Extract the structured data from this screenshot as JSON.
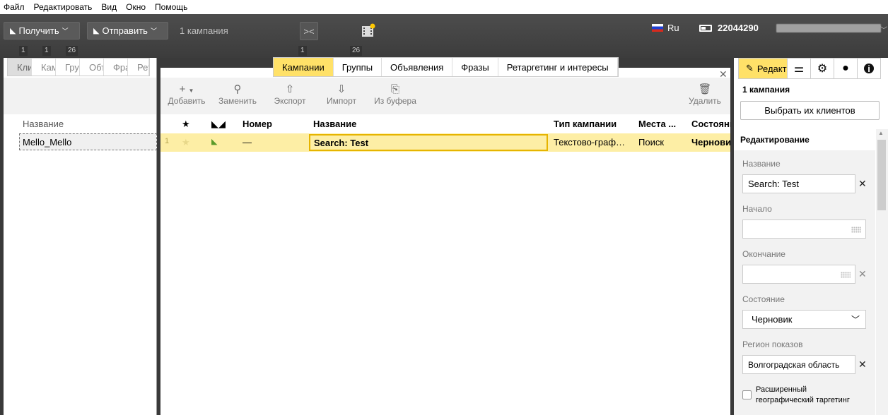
{
  "menu": [
    "Файл",
    "Редактировать",
    "Вид",
    "Окно",
    "Помощь"
  ],
  "toolbar": {
    "get_label": "Получить",
    "send_label": "Отправить",
    "campaign_count": "1 кампания",
    "lang": "Ru",
    "account_id": "22044290"
  },
  "left": {
    "counters": [
      "1",
      "1",
      "26"
    ],
    "tabs": [
      "Клиенты",
      "Кампании",
      "Группы",
      "Объявления",
      "Фразы",
      "Ретаргетинг"
    ],
    "column_header": "Название",
    "row_name": "Mello_Mello"
  },
  "main": {
    "counters": [
      "1",
      "26"
    ],
    "tabs": [
      "Кампании",
      "Группы",
      "Объявления",
      "Фразы",
      "Ретаргетинг и интересы"
    ],
    "tools": {
      "add": "Добавить",
      "replace": "Заменить",
      "export": "Экспорт",
      "import": "Импорт",
      "from_buffer": "Из буфера",
      "delete": "Удалить"
    },
    "columns": [
      "Номер",
      "Название",
      "Тип кампании",
      "Места ...",
      "Состояние"
    ],
    "row": {
      "index": "1",
      "number": "—",
      "name": "Search: Test",
      "type": "Текстово-графические",
      "places": "Поиск",
      "state": "Черновик"
    }
  },
  "right": {
    "tab_edit": "Редактирование",
    "campaign_count": "1 кампания",
    "choose_clients": "Выбрать их клиентов",
    "section_title": "Редактирование",
    "name_label": "Название",
    "name_value": "Search: Test",
    "start_label": "Начало",
    "start_value": "",
    "end_label": "Окончание",
    "end_value": "",
    "state_label": "Состояние",
    "state_value": "Черновик",
    "region_label": "Регион показов",
    "region_value": "Волгоградская область",
    "geo_checkbox": "Расширенный географический таргетинг"
  }
}
